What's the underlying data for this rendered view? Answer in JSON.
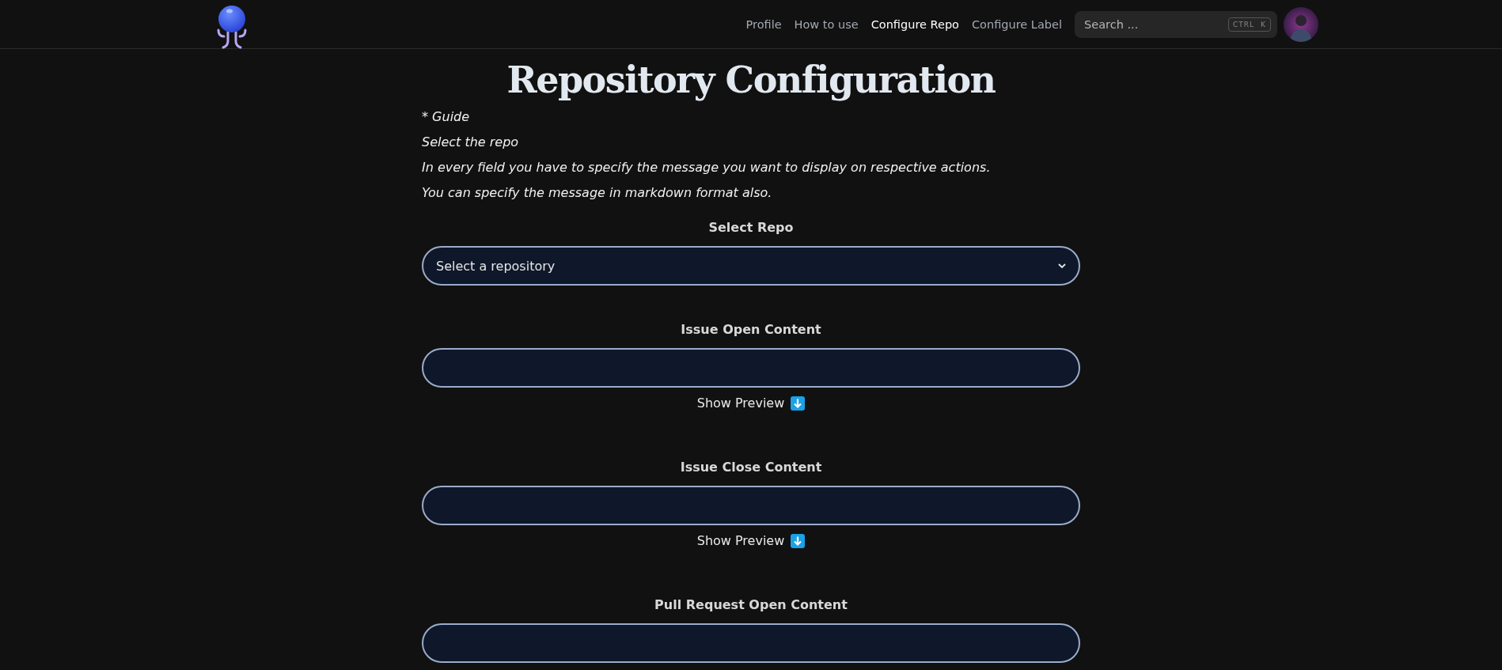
{
  "nav": {
    "links": [
      {
        "label": "Profile",
        "selected": false
      },
      {
        "label": "How to use",
        "selected": false
      },
      {
        "label": "Configure Repo",
        "selected": true
      },
      {
        "label": "Configure Label",
        "selected": false
      }
    ],
    "search": {
      "placeholder": "Search ...",
      "shortcut": [
        "CTRL",
        "K"
      ]
    }
  },
  "page": {
    "title": "Repository Configuration",
    "guide": [
      "* Guide",
      "Select the repo",
      "In every field you have to specify the message you want to display on respective actions.",
      "You can specify the message in markdown format also."
    ],
    "fields": [
      {
        "kind": "select",
        "label": "Select Repo",
        "value": "Select a repository"
      },
      {
        "kind": "text",
        "label": "Issue Open Content",
        "preview": "Show Preview"
      },
      {
        "kind": "text",
        "label": "Issue Close Content",
        "preview": "Show Preview"
      },
      {
        "kind": "text",
        "label": "Pull Request Open Content"
      }
    ]
  }
}
